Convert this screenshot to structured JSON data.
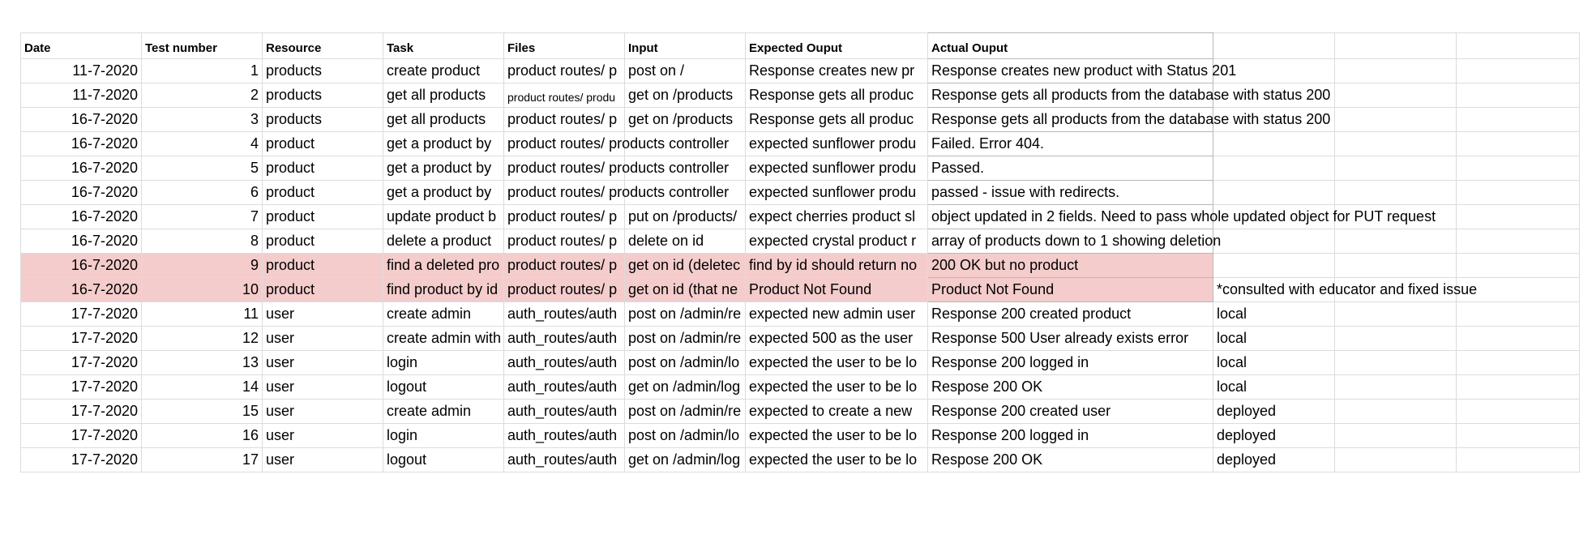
{
  "columns": [
    "Date",
    "Test number",
    "Resource",
    "Task",
    "Files",
    "Input",
    "Expected Ouput",
    "Actual Ouput",
    "",
    "",
    ""
  ],
  "rows": [
    {
      "date": "11-7-2020",
      "num": "1",
      "resource": "products",
      "task": "create product",
      "files": "product routes/ p",
      "input": "post on /",
      "expected": "Response creates new pr",
      "actual": "Response creates new product with Status 201",
      "extra": ""
    },
    {
      "date": "11-7-2020",
      "num": "2",
      "resource": "products",
      "task": "get all products",
      "files": "product routes/ produ",
      "input": "get on /products",
      "expected": "Response gets all produc",
      "actual": "Response gets all products from the database with status 200",
      "extra": ""
    },
    {
      "date": "16-7-2020",
      "num": "3",
      "resource": "products",
      "task": "get all products",
      "files": "product routes/ p",
      "input": "get on /products",
      "expected": "Response gets all produc",
      "actual": "Response gets all products from the database with status 200",
      "extra": ""
    },
    {
      "date": "16-7-2020",
      "num": "4",
      "resource": "product",
      "task": "get a product by",
      "files": "product routes/ products controller",
      "input": "",
      "expected": "expected sunflower produ",
      "actual": "Failed. Error 404.",
      "extra": ""
    },
    {
      "date": "16-7-2020",
      "num": "5",
      "resource": "product",
      "task": "get a product by",
      "files": "product routes/ products controller",
      "input": "",
      "expected": "expected sunflower produ",
      "actual": "Passed.",
      "extra": ""
    },
    {
      "date": "16-7-2020",
      "num": "6",
      "resource": "product",
      "task": "get a product by",
      "files": "product routes/ products controller",
      "input": "",
      "expected": "expected sunflower produ",
      "actual": "passed - issue with redirects.",
      "extra": ""
    },
    {
      "date": "16-7-2020",
      "num": "7",
      "resource": "product",
      "task": "update product b",
      "files": "product routes/ p",
      "input": "put on /products/",
      "expected": "expect cherries product sl",
      "actual": "object updated in 2 fields. Need to pass whole updated object for PUT request",
      "extra": ""
    },
    {
      "date": "16-7-2020",
      "num": "8",
      "resource": "product",
      "task": "delete a product",
      "files": "product routes/ p",
      "input": "delete on id",
      "expected": "expected crystal product r",
      "actual": "array of products down to 1 showing deletion",
      "extra": ""
    },
    {
      "date": "16-7-2020",
      "num": "9",
      "resource": "product",
      "task": "find a deleted pro",
      "files": "product routes/ p",
      "input": "get on id (deletec",
      "expected": "find by id should return no",
      "actual": "200 OK but no product",
      "extra": ""
    },
    {
      "date": "16-7-2020",
      "num": "10",
      "resource": "product",
      "task": "find product by id",
      "files": "product routes/ p",
      "input": "get on id (that ne",
      "expected": "Product Not Found",
      "actual": "Product Not Found",
      "extra": "*consulted with educator and fixed issue"
    },
    {
      "date": "17-7-2020",
      "num": "11",
      "resource": "user",
      "task": "create admin",
      "files": "auth_routes/auth",
      "input": "post on /admin/re",
      "expected": "expected new admin user",
      "actual": "Response 200 created product",
      "extra": "local"
    },
    {
      "date": "17-7-2020",
      "num": "12",
      "resource": "user",
      "task": "create admin with",
      "files": "auth_routes/auth",
      "input": "post on /admin/re",
      "expected": "expected 500 as the user",
      "actual": "Response 500 User already exists error",
      "extra": "local"
    },
    {
      "date": "17-7-2020",
      "num": "13",
      "resource": "user",
      "task": "login",
      "files": "auth_routes/auth",
      "input": "post on /admin/lo",
      "expected": "expected the user to be lo",
      "actual": "Response 200 logged in",
      "extra": "local"
    },
    {
      "date": "17-7-2020",
      "num": "14",
      "resource": "user",
      "task": "logout",
      "files": "auth_routes/auth",
      "input": "get on /admin/log",
      "expected": "expected the user to be lo",
      "actual": "Respose 200 OK",
      "extra": "local"
    },
    {
      "date": "17-7-2020",
      "num": "15",
      "resource": "user",
      "task": "create admin",
      "files": "auth_routes/auth",
      "input": "post on /admin/re",
      "expected": "expected to create a new",
      "actual": "Response 200 created user",
      "extra": "deployed"
    },
    {
      "date": "17-7-2020",
      "num": "16",
      "resource": "user",
      "task": "login",
      "files": "auth_routes/auth",
      "input": "post on /admin/lo",
      "expected": "expected the user to be lo",
      "actual": "Response 200 logged in",
      "extra": "deployed"
    },
    {
      "date": "17-7-2020",
      "num": "17",
      "resource": "user",
      "task": "logout",
      "files": "auth_routes/auth",
      "input": "get on /admin/log",
      "expected": "expected the user to be lo",
      "actual": "Respose 200 OK",
      "extra": "deployed"
    }
  ],
  "colors": {
    "highlight_row": "#f4cccc",
    "grid": "#dadce0"
  }
}
